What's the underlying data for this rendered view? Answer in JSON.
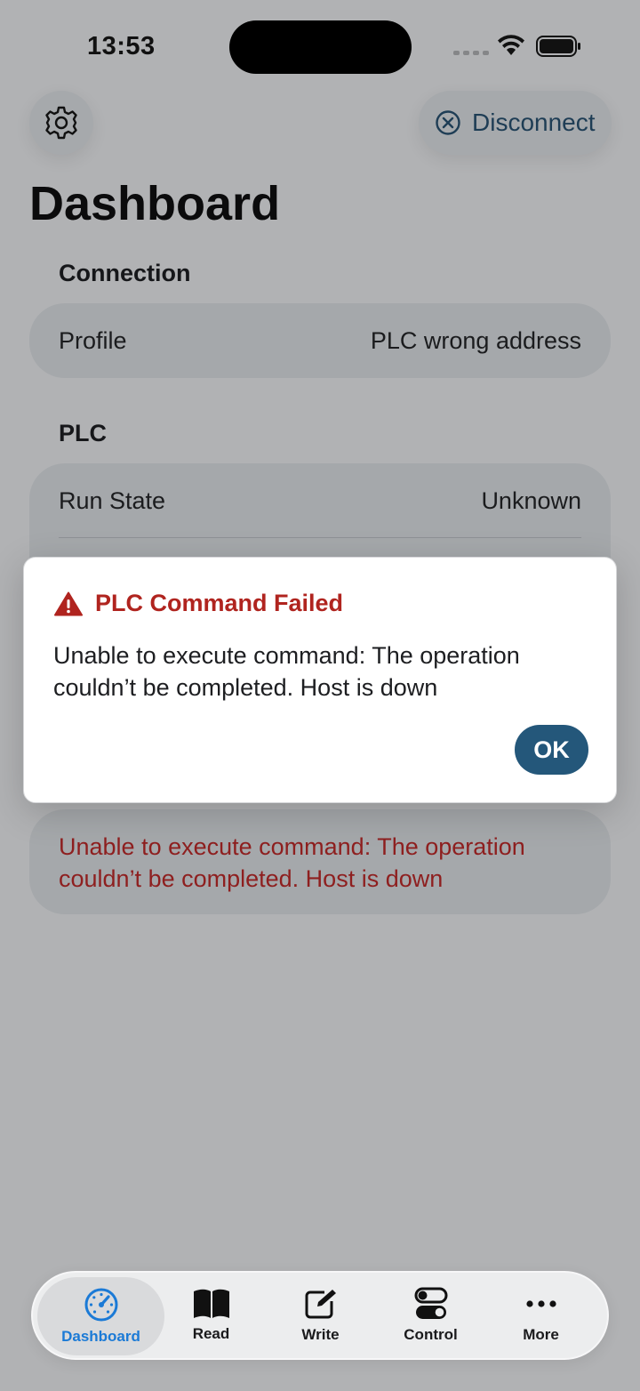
{
  "status_bar": {
    "time": "13:53"
  },
  "header": {
    "settings_icon": "gear-icon",
    "disconnect_label": "Disconnect",
    "disconnect_icon": "circle-x-icon",
    "title": "Dashboard"
  },
  "connection": {
    "header": "Connection",
    "profile_label": "Profile",
    "profile_value": "PLC wrong address"
  },
  "plc": {
    "header": "PLC",
    "run_state_label": "Run State",
    "run_state_value": "Unknown"
  },
  "error_card": {
    "message": "Unable to execute command: The operation couldn’t be completed. Host is down"
  },
  "alert": {
    "icon": "warning-triangle-icon",
    "title": "PLC Command Failed",
    "message": "Unable to execute command: The operation couldn’t be completed. Host is down",
    "ok_label": "OK"
  },
  "tab_bar": {
    "tabs": [
      {
        "label": "Dashboard",
        "icon": "gauge-icon",
        "active": true
      },
      {
        "label": "Read",
        "icon": "book-icon",
        "active": false
      },
      {
        "label": "Write",
        "icon": "pencil-square-icon",
        "active": false
      },
      {
        "label": "Control",
        "icon": "toggles-icon",
        "active": false
      },
      {
        "label": "More",
        "icon": "ellipsis-icon",
        "active": false
      }
    ]
  },
  "colors": {
    "accent": "#1b7ad6",
    "alert_title": "#b0241f",
    "error_text": "#8e1f1f",
    "ok_button": "#24577a",
    "dim_background": "#b1b2b4"
  }
}
